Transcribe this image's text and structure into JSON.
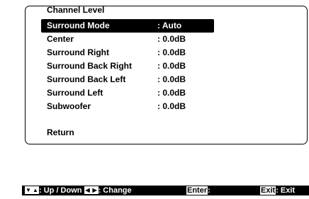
{
  "menu": {
    "title": "Channel Level",
    "items": [
      {
        "label": "Surround Mode",
        "value": ": Auto",
        "selected": true
      },
      {
        "label": "Center",
        "value": ": 0.0dB"
      },
      {
        "label": "Surround Right",
        "value": ": 0.0dB"
      },
      {
        "label": "Surround Back Right",
        "value": ": 0.0dB"
      },
      {
        "label": "Surround Back Left",
        "value": ": 0.0dB"
      },
      {
        "label": "Surround Left",
        "value": ": 0.0dB"
      },
      {
        "label": "Subwoofer",
        "value": ": 0.0dB"
      }
    ],
    "return_label": "Return"
  },
  "help": {
    "up_down_label": ": Up / Down",
    "change_label": ": Change",
    "enter_key": "Enter",
    "enter_suffix": ":",
    "exit_key": "Exit",
    "exit_suffix": ": Exit"
  },
  "colors": {
    "background": "#ffffff",
    "highlight": "#000000",
    "help_bar": "#000000"
  }
}
